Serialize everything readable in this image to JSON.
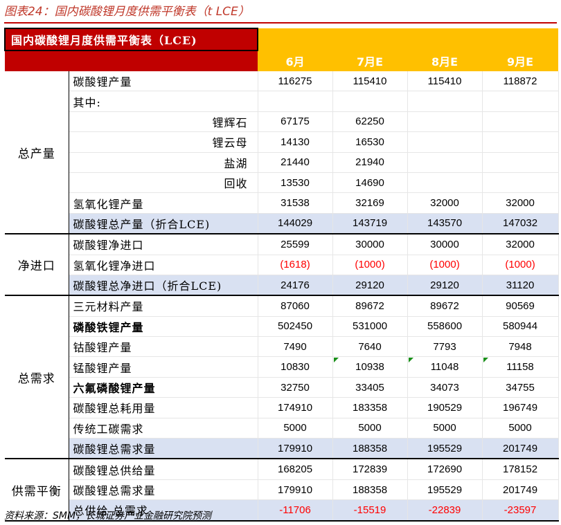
{
  "figure_title": "图表24：国内碳酸锂月度供需平衡表（t LCE）",
  "table_title": "国内碳酸锂月度供需平衡表（LCE)",
  "columns": [
    "6月",
    "7月E",
    "8月E",
    "9月E"
  ],
  "groups": [
    {
      "name": "总产量",
      "rows": [
        {
          "label": "碳酸锂产量",
          "values": [
            "116275",
            "115410",
            "115410",
            "118872"
          ]
        },
        {
          "label": "其中:",
          "values": [
            "",
            "",
            "",
            ""
          ]
        },
        {
          "label": "锂辉石",
          "align": "right",
          "values": [
            "67175",
            "62250",
            "",
            ""
          ]
        },
        {
          "label": "锂云母",
          "align": "right",
          "values": [
            "14130",
            "16530",
            "",
            ""
          ]
        },
        {
          "label": "盐湖",
          "align": "right",
          "values": [
            "21440",
            "21940",
            "",
            ""
          ]
        },
        {
          "label": "回收",
          "align": "right",
          "values": [
            "13530",
            "14690",
            "",
            ""
          ]
        },
        {
          "label": "氢氧化锂产量",
          "values": [
            "31538",
            "32169",
            "32000",
            "32000"
          ]
        },
        {
          "label": "碳酸锂总产量（折合LCE)",
          "total": true,
          "values": [
            "144029",
            "143719",
            "143570",
            "147032"
          ]
        }
      ]
    },
    {
      "name": "净进口",
      "rows": [
        {
          "label": "碳酸锂净进口",
          "values": [
            "25599",
            "30000",
            "30000",
            "32000"
          ]
        },
        {
          "label": "氢氧化锂净进口",
          "red": true,
          "values": [
            "(1618)",
            "(1000)",
            "(1000)",
            "(1000)"
          ]
        },
        {
          "label": "碳酸锂总净进口（折合LCE)",
          "total": true,
          "values": [
            "24176",
            "29120",
            "29120",
            "31120"
          ]
        }
      ]
    },
    {
      "name": "总需求",
      "rows": [
        {
          "label": "三元材料产量",
          "values": [
            "87060",
            "89672",
            "89672",
            "90569"
          ]
        },
        {
          "label": "磷酸铁锂产量",
          "bold": true,
          "values": [
            "502450",
            "531000",
            "558600",
            "580944"
          ]
        },
        {
          "label": "钴酸锂产量",
          "values": [
            "7490",
            "7640",
            "7793",
            "7948"
          ]
        },
        {
          "label": "锰酸锂产量",
          "marks": true,
          "values": [
            "10830",
            "10938",
            "11048",
            "11158"
          ]
        },
        {
          "label": "六氟磷酸锂产量",
          "bold": true,
          "values": [
            "32750",
            "33405",
            "34073",
            "34755"
          ]
        },
        {
          "label": "碳酸锂总耗用量",
          "values": [
            "174910",
            "183358",
            "190529",
            "196749"
          ]
        },
        {
          "label": "传统工碳需求",
          "values": [
            "5000",
            "5000",
            "5000",
            "5000"
          ]
        },
        {
          "label": "碳酸锂总需求量",
          "total": true,
          "values": [
            "179910",
            "188358",
            "195529",
            "201749"
          ]
        }
      ]
    },
    {
      "name": "供需平衡",
      "rows": [
        {
          "label": "碳酸锂总供给量",
          "values": [
            "168205",
            "172839",
            "172690",
            "178152"
          ]
        },
        {
          "label": "碳酸锂总需求量",
          "values": [
            "179910",
            "188358",
            "195529",
            "201749"
          ]
        },
        {
          "label": "总供给-总需求",
          "total": true,
          "red": true,
          "values": [
            "-11706",
            "-15519",
            "-22839",
            "-23597"
          ]
        }
      ]
    }
  ],
  "source": "资料来源：SMM，长城证券产业金融研究院预测"
}
